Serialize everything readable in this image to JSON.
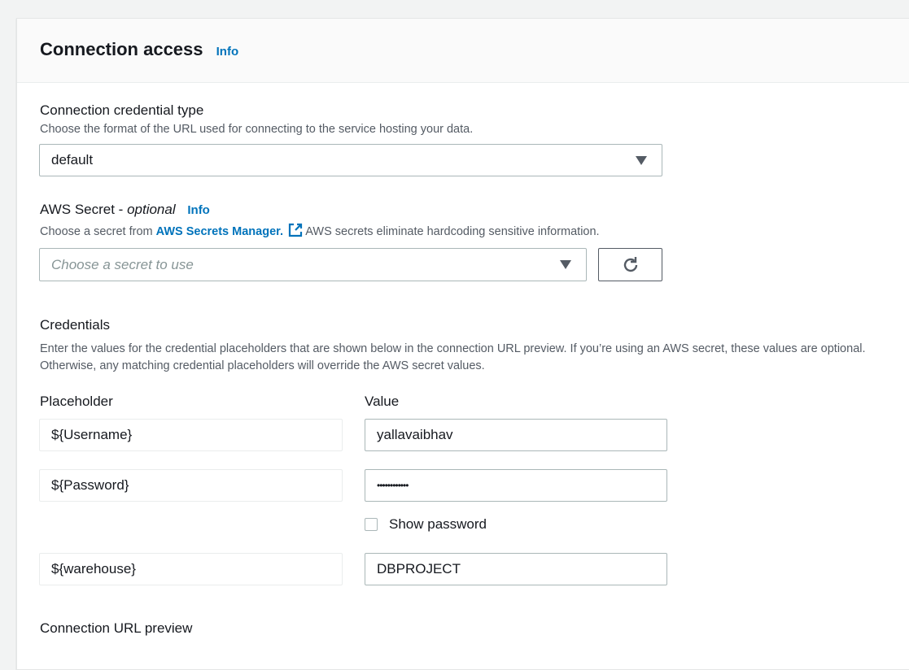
{
  "section": {
    "title": "Connection access",
    "info": "Info"
  },
  "credential_type": {
    "label": "Connection credential type",
    "description": "Choose the format of the URL used for connecting to the service hosting your data.",
    "selected": "default"
  },
  "aws_secret": {
    "label": "AWS Secret - ",
    "label_optional": "optional",
    "info": "Info",
    "description_prefix": "Choose a secret from ",
    "link": "AWS Secrets Manager.",
    "description_suffix": " AWS secrets eliminate hardcoding sensitive information.",
    "placeholder": "Choose a secret to use"
  },
  "credentials": {
    "label": "Credentials",
    "description": "Enter the values for the credential placeholders that are shown below in the connection URL preview. If you’re using an AWS secret, these values are optional. Otherwise, any matching credential placeholders will override the AWS secret values.",
    "placeholder_header": "Placeholder",
    "value_header": "Value",
    "rows": [
      {
        "placeholder": "${Username}",
        "value": "yallavaibhav"
      },
      {
        "placeholder": "${Password}",
        "value": "••••••••••••"
      },
      {
        "placeholder": "${warehouse}",
        "value": "DBPROJECT"
      }
    ],
    "show_password": "Show password"
  },
  "url_preview": {
    "label": "Connection URL preview"
  }
}
